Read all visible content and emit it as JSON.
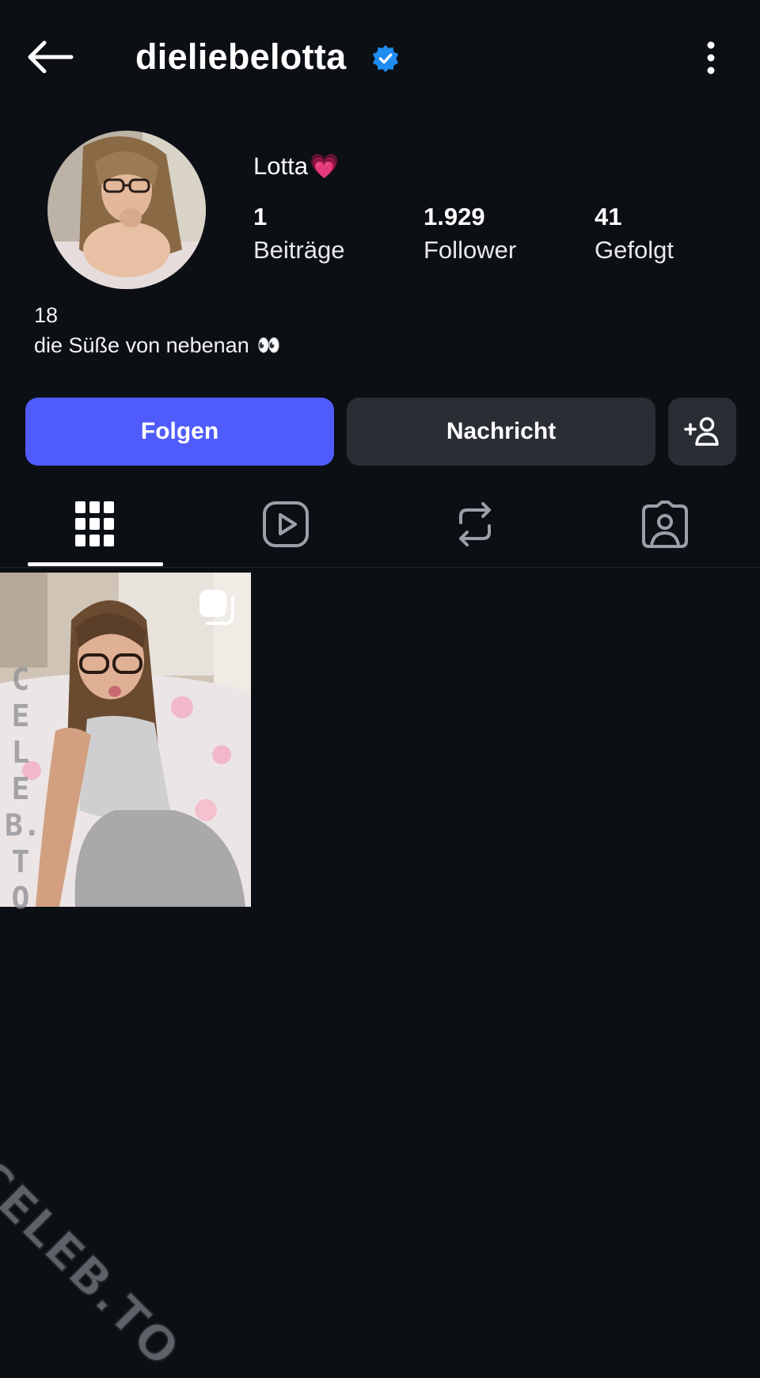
{
  "header": {
    "username": "dieliebelotta",
    "verified": true,
    "back_icon": "arrow-left-icon",
    "more_icon": "vertical-ellipsis-icon"
  },
  "profile": {
    "display_name": "Lotta",
    "display_name_emoji": "💗",
    "stats": [
      {
        "value": "1",
        "label": "Beiträge"
      },
      {
        "value": "1.929",
        "label": "Follower"
      },
      {
        "value": "41",
        "label": "Gefolgt"
      }
    ],
    "bio_line1": "18",
    "bio_line2": "die Süße von nebenan",
    "bio_emoji": "👀"
  },
  "actions": {
    "follow_label": "Folgen",
    "message_label": "Nachricht",
    "add_user_icon": "add-person-icon"
  },
  "tabs": [
    {
      "icon": "grid-icon",
      "active": true
    },
    {
      "icon": "reels-icon",
      "active": false
    },
    {
      "icon": "repost-icon",
      "active": false
    },
    {
      "icon": "tagged-icon",
      "active": false
    }
  ],
  "posts": [
    {
      "type": "carousel"
    }
  ],
  "watermark": {
    "vertical": "CELEB.TO",
    "diagonal": "CELEB.TO"
  },
  "colors": {
    "background": "#0c0f14",
    "follow_button": "#4f5bfa",
    "secondary_button": "#2a2e34",
    "verified_badge": "#1f8cf0"
  }
}
